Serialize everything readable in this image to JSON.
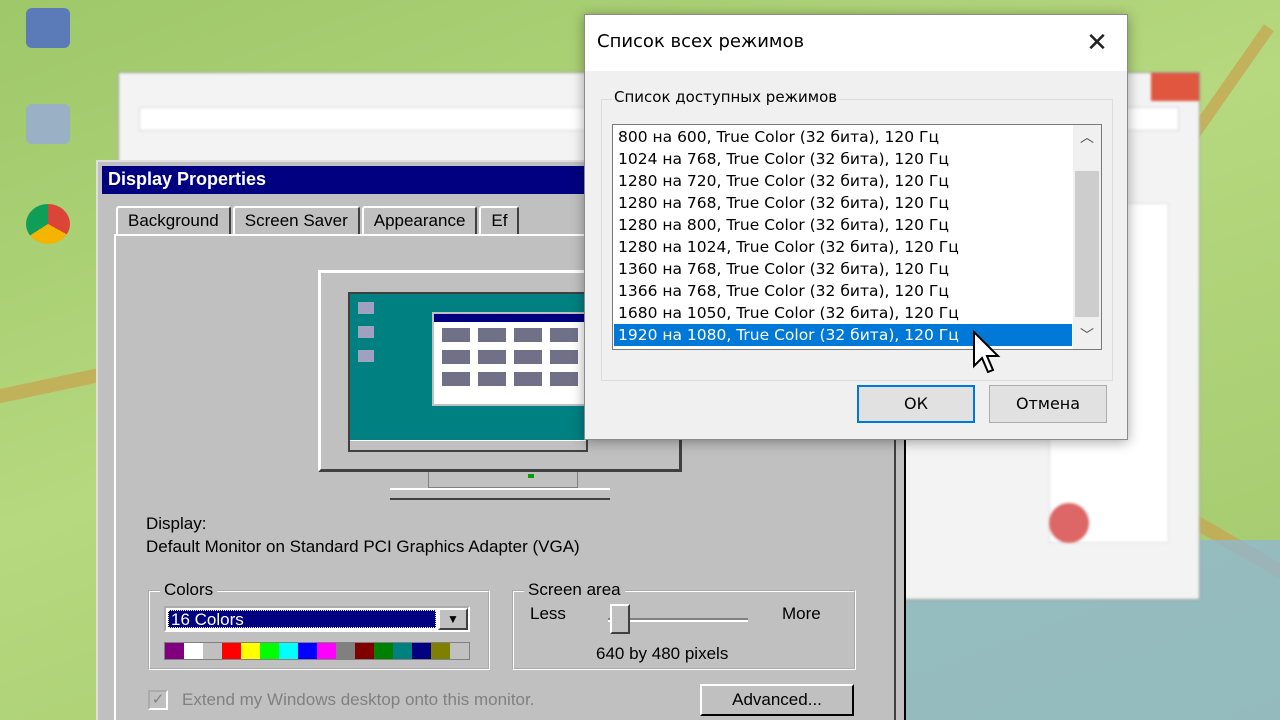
{
  "display_properties": {
    "title": "Display Properties",
    "tabs": [
      "Background",
      "Screen Saver",
      "Appearance",
      "Ef"
    ],
    "display_label": "Display:",
    "display_value": "Default Monitor on Standard PCI Graphics Adapter (VGA)",
    "colors": {
      "group_label": "Colors",
      "selected": "16 Colors",
      "palette": [
        "#800080",
        "#ffffff",
        "#c0c0c0",
        "#ff0000",
        "#ffff00",
        "#00ff00",
        "#00ffff",
        "#0000ff",
        "#ff00ff",
        "#808080",
        "#800000",
        "#008000",
        "#008080",
        "#000080",
        "#808000",
        "#c0c0c0"
      ]
    },
    "screen_area": {
      "group_label": "Screen area",
      "less": "Less",
      "more": "More",
      "value": "640 by 480 pixels",
      "slider_position": 0
    },
    "extend_checkbox": "Extend my Windows desktop onto this monitor.",
    "advanced_button": "Advanced..."
  },
  "mode_dialog": {
    "title": "Список всех режимов",
    "group_label": "Список доступных режимов",
    "modes": [
      "800 на 600, True Color (32 бита), 120 Гц",
      "1024 на 768, True Color (32 бита), 120 Гц",
      "1280 на 720, True Color (32 бита), 120 Гц",
      "1280 на 768, True Color (32 бита), 120 Гц",
      "1280 на 800, True Color (32 бита), 120 Гц",
      "1280 на 1024, True Color (32 бита), 120 Гц",
      "1360 на 768, True Color (32 бита), 120 Гц",
      "1366 на 768, True Color (32 бита), 120 Гц",
      "1680 на 1050, True Color (32 бита), 120 Гц",
      "1920 на 1080, True Color (32 бита), 120 Гц"
    ],
    "selected_index": 9,
    "ok_button": "ОК",
    "cancel_button": "Отмена"
  },
  "colors": {
    "win95_title_bar": "#000080",
    "win95_face": "#c0c0c0",
    "win10_selection": "#0078d7",
    "win10_face": "#f0f0f0"
  }
}
